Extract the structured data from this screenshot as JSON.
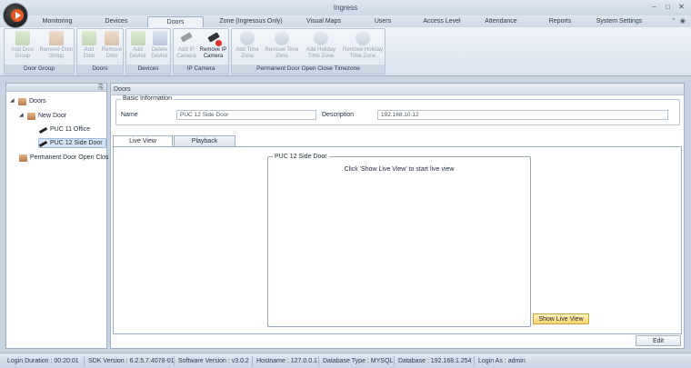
{
  "window": {
    "title": "Ingress"
  },
  "tabs": [
    "Monitoring",
    "Devices",
    "Doors",
    "Zone (Ingressus Only)",
    "Visual Maps",
    "Users",
    "Access Level",
    "Attendance",
    "Reports",
    "System Settings"
  ],
  "active_tab": "Doors",
  "ribbon": {
    "groups": [
      {
        "label": "Door Group",
        "buttons": [
          {
            "line1": "Add Door",
            "line2": "Group",
            "icon": "add-door-group-icon"
          },
          {
            "line1": "Remove Door",
            "line2": "Group",
            "icon": "remove-door-group-icon"
          }
        ]
      },
      {
        "label": "Doors",
        "buttons": [
          {
            "line1": "Add",
            "line2": "Door",
            "icon": "add-door-icon"
          },
          {
            "line1": "Remove",
            "line2": "Door",
            "icon": "remove-door-icon"
          }
        ]
      },
      {
        "label": "Devices",
        "buttons": [
          {
            "line1": "Add",
            "line2": "Device",
            "icon": "add-device-icon"
          },
          {
            "line1": "Delete",
            "line2": "Device",
            "icon": "delete-device-icon"
          }
        ]
      },
      {
        "label": "IP Camera",
        "buttons": [
          {
            "line1": "Add IP",
            "line2": "Camera",
            "icon": "add-ip-camera-icon"
          },
          {
            "line1": "Remove IP",
            "line2": "Camera",
            "icon": "remove-ip-camera-icon"
          }
        ]
      },
      {
        "label": "Permanent Door Open Close Timezone",
        "buttons": [
          {
            "line1": "Add Time",
            "line2": "Zone",
            "icon": "add-time-zone-icon"
          },
          {
            "line1": "Remove Time",
            "line2": "Zone",
            "icon": "remove-time-zone-icon"
          },
          {
            "line1": "Add Holiday",
            "line2": "Time Zone",
            "icon": "add-holiday-icon"
          },
          {
            "line1": "Remove Holiday",
            "line2": "Time Zone",
            "icon": "remove-holiday-icon"
          }
        ]
      }
    ]
  },
  "tree": {
    "items": [
      {
        "label": "Doors",
        "icon": "door-folder-icon"
      },
      {
        "label": "New Door",
        "icon": "door-icon"
      },
      {
        "label": "PUC 11 Office",
        "icon": "camera-icon"
      },
      {
        "label": "PUC 12 Side Door",
        "icon": "camera-icon"
      },
      {
        "label": "Permanent Door Open Clos",
        "icon": "door-icon"
      }
    ],
    "selected": "PUC 12 Side Door"
  },
  "main": {
    "header": "Doors",
    "basic_info": {
      "legend": "Basic Information",
      "name_label": "Name",
      "name_value": "PUC 12 Side Door",
      "description_label": "Description",
      "description_value": "192.168.10.12"
    },
    "subtabs": [
      "Live View",
      "Playback"
    ],
    "video": {
      "title": "PUC 12 Side Door",
      "message": "Click 'Show Live View' to start live view"
    },
    "show_live_view_label": "Show Live View",
    "edit_label": "Edit"
  },
  "status": {
    "items": [
      "Login Duration : 00:20:01",
      "SDK Version : 6.2.5.7.4078-01",
      "Software Version : v3.0.2",
      "Hostname : 127.0.0.1",
      "Database Type : MYSQL",
      "Database : 192.168.1.254",
      "Login As : admin"
    ]
  },
  "colors": {
    "accent": "#e8592a",
    "live_view_button": "#f7d46b",
    "selection": "#d5e3f3"
  }
}
